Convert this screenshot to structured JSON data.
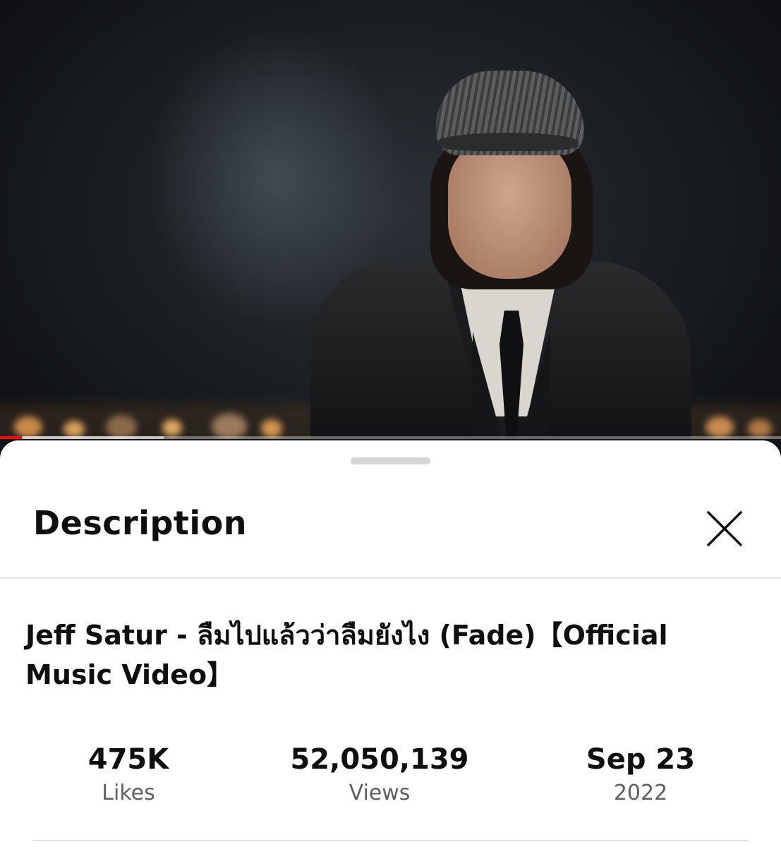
{
  "video": {
    "progress_played": 0.028,
    "progress_buffered": 0.21,
    "accent_color": "#ff0000"
  },
  "sheet": {
    "title": "Description",
    "close_icon": "close-icon"
  },
  "video_title": "Jeff Satur - ลืมไปแล้วว่าลืมยังไง (Fade)【Official Music Video】",
  "stats": {
    "likes": {
      "value": "475K",
      "label": "Likes"
    },
    "views": {
      "value": "52,050,139",
      "label": "Views"
    },
    "date": {
      "value": "Sep 23",
      "label": "2022"
    }
  }
}
